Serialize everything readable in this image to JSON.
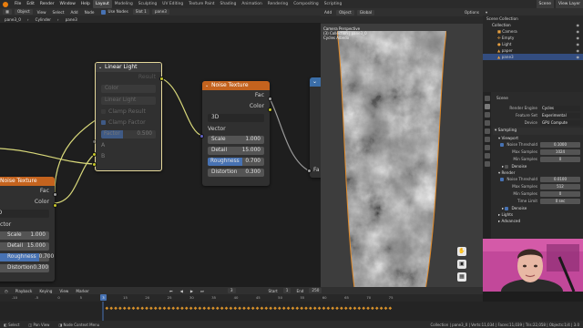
{
  "menubar": {
    "menus": [
      "File",
      "Edit",
      "Render",
      "Window",
      "Help"
    ],
    "workspaces": [
      "Layout",
      "Modeling",
      "Sculpting",
      "UV Editing",
      "Texture Paint",
      "Shading",
      "Animation",
      "Rendering",
      "Compositing",
      "Scripting"
    ],
    "active_workspace": "Layout",
    "scene": "Scene",
    "view_layer": "View Layer"
  },
  "node_editor": {
    "header": {
      "type": "Object",
      "menus": [
        "View",
        "Select",
        "Add",
        "Node"
      ],
      "use_nodes": "Use Nodes",
      "slot": "Slot 1",
      "material": "pane3"
    },
    "breadcrumb": [
      "pane3_0",
      "Cylinder",
      "pane3"
    ],
    "linear_light": {
      "title": "Linear Light",
      "output": "Result",
      "dropdown": "Color",
      "blend_dropdown": "Linear Light",
      "clamp_result": "Clamp Result",
      "clamp_factor": "Clamp Factor",
      "factor_label": "Factor",
      "factor_value": "0.500",
      "input_a": "A",
      "input_b": "B"
    },
    "noise_right": {
      "title": "Noise Texture",
      "out_fac": "Fac",
      "out_color": "Color",
      "dimensions": "3D",
      "vector": "Vector",
      "fields": [
        {
          "label": "Scale",
          "value": "1.000"
        },
        {
          "label": "Detail",
          "value": "15.000"
        },
        {
          "label": "Roughness",
          "value": "0.700"
        },
        {
          "label": "Distortion",
          "value": "0.300"
        }
      ]
    },
    "noise_left": {
      "title": "Noise Texture",
      "out_fac": "Fac",
      "out_color": "Color",
      "dimensions": "3D",
      "vector": "ctor",
      "fields": [
        {
          "label": "Scale",
          "value": "1.000"
        },
        {
          "label": "Detail",
          "value": "15.000"
        },
        {
          "label": "Roughness",
          "value": "0.700"
        },
        {
          "label": "Distortion",
          "value": "0.300"
        }
      ]
    },
    "partial_node_socket": "Fa"
  },
  "viewport": {
    "header": {
      "menus": [
        "Add",
        "Object"
      ],
      "transform": "Global",
      "options": "Options"
    },
    "info": [
      "Camera Perspective",
      "(3) Collection | pane3_0",
      "Cycles Albedo",
      "Sample 1"
    ],
    "tools": [
      "hand-icon",
      "camera-icon",
      "grid-icon"
    ]
  },
  "outliner": {
    "title": "Scene Collection",
    "items": [
      {
        "label": "Collection",
        "indent": 1
      },
      {
        "label": "Camera",
        "indent": 2
      },
      {
        "label": "Empty",
        "indent": 2
      },
      {
        "label": "Light",
        "indent": 2
      },
      {
        "label": "paper",
        "indent": 2
      },
      {
        "label": "pane3",
        "indent": 2
      }
    ],
    "selected_index": 5
  },
  "properties": {
    "title": "Scene",
    "render_engine_label": "Render Engine",
    "render_engine": "Cycles",
    "feature_set_label": "Feature Set",
    "feature_set": "Experimental",
    "device_label": "Device",
    "device": "GPU Compute",
    "sampling": "Sampling",
    "viewport": "Viewport",
    "vp_noise_threshold_label": "Noise Threshold",
    "vp_noise_threshold": "0.1000",
    "vp_max_samples_label": "Max Samples",
    "vp_max_samples": "1024",
    "vp_min_samples_label": "Min Samples",
    "vp_min_samples": "0",
    "denoise": "Denoise",
    "render": "Render",
    "r_noise_threshold_label": "Noise Threshold",
    "r_noise_threshold": "0.0100",
    "r_max_samples_label": "Max Samples",
    "r_max_samples": "512",
    "r_min_samples_label": "Min Samples",
    "r_min_samples": "0",
    "time_limit_label": "Time Limit",
    "time_limit": "0 sec",
    "denoise2": "Denoise",
    "lights": "Lights",
    "advanced": "Advanced"
  },
  "timeline": {
    "menus": [
      "Playback",
      "Keying",
      "View",
      "Marker"
    ],
    "start_label": "Start",
    "start": "1",
    "end_label": "End",
    "end": "250",
    "current_frame": "3",
    "ruler_ticks": [
      "-10",
      "-5",
      "0",
      "5",
      "10",
      "15",
      "20",
      "25",
      "30",
      "35",
      "40",
      "45",
      "50",
      "55",
      "60",
      "65",
      "70",
      "75"
    ]
  },
  "status_bar": {
    "items": [
      "Select",
      "Pan View",
      "Node Context Menu"
    ],
    "stats": "Collection | pane3_0 | Verts:11,034 | Faces:11,039 | Tris:22,058 | Objects:1/4 | 3.0"
  },
  "colors": {
    "noise_header": "#c4631e",
    "converter_header": "#3c3c3c",
    "selection_outline": "#e6d99b",
    "accent_blue": "#4772b3",
    "socket_yellow": "#c7c729",
    "socket_grey": "#a1a1a1",
    "socket_purple": "#6363c7"
  }
}
